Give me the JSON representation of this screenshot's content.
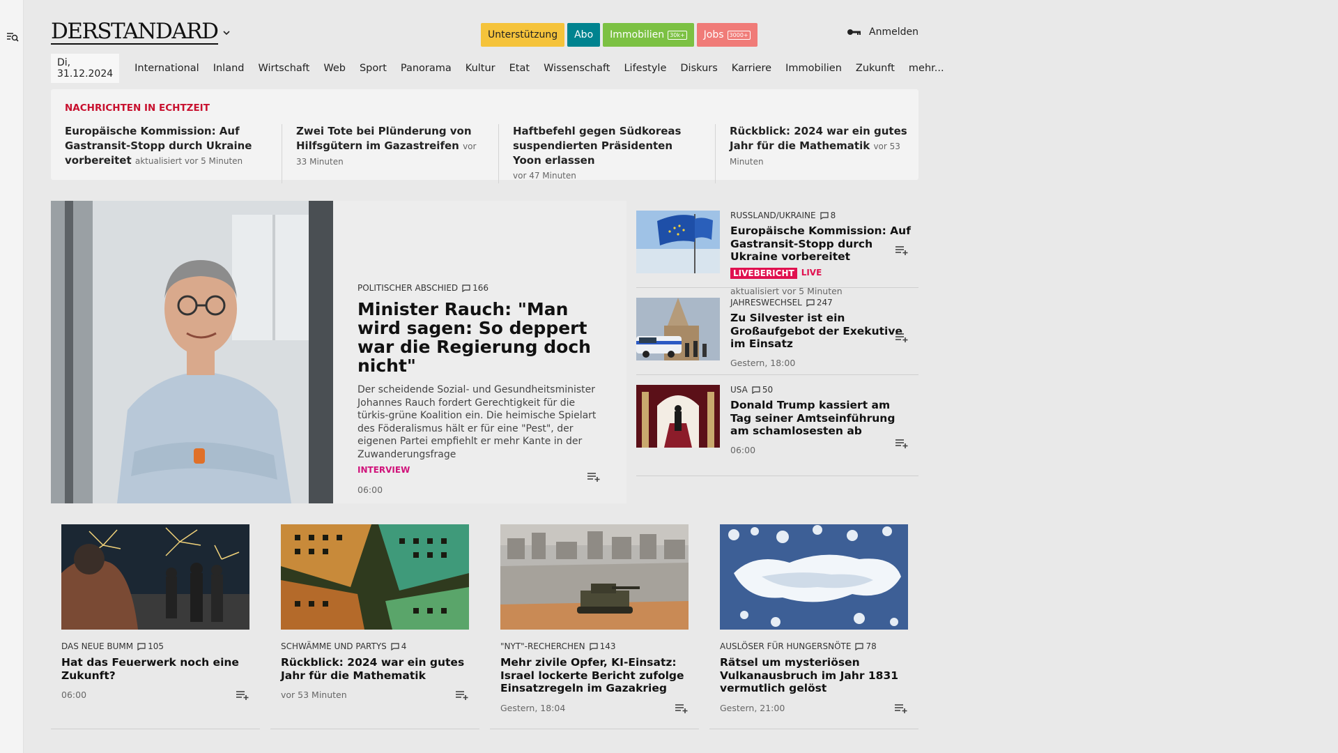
{
  "brand": {
    "logo": "DERSTANDARD"
  },
  "header": {
    "pills": [
      {
        "label": "Unterstützung",
        "badge": "",
        "bg": "#f5c33b",
        "fg": "#222222"
      },
      {
        "label": "Abo",
        "badge": "",
        "bg": "#00838f",
        "fg": "#ffffff"
      },
      {
        "label": "Immobilien",
        "badge": "30k+",
        "bg": "#7cc143",
        "fg": "#ffffff"
      },
      {
        "label": "Jobs",
        "badge": "3000+",
        "bg": "#f07b78",
        "fg": "#ffffff"
      }
    ],
    "login": "Anmelden"
  },
  "nav": {
    "date": "Di, 31.12.2024",
    "items": [
      "International",
      "Inland",
      "Wirtschaft",
      "Web",
      "Sport",
      "Panorama",
      "Kultur",
      "Etat",
      "Wissenschaft",
      "Lifestyle",
      "Diskurs",
      "Karriere",
      "Immobilien",
      "Zukunft",
      "mehr..."
    ]
  },
  "ticker": {
    "title": "NACHRICHTEN IN ECHTZEIT",
    "items": [
      {
        "title": "Europäische Kommission: Auf Gas­transit-Stopp durch Ukraine vorberei­tet",
        "time": "aktualisiert vor 5 Minuten"
      },
      {
        "title": "Zwei Tote bei Plünderung von Hilfsgü­tern im Gazastreifen",
        "time": "vor 33 Minuten"
      },
      {
        "title": "Haftbefehl gegen Südkoreas suspen­dierten Präsidenten Yoon erlassen",
        "time": "vor 47 Minuten"
      },
      {
        "title": "Rückblick: 2024 war ein gutes Jahr für die Mathematik",
        "time": "vor 53 Minuten"
      }
    ]
  },
  "hero": {
    "kicker": "POLITISCHER ABSCHIED",
    "comments": "166",
    "title": "Minister Rauch: \"Man wird sagen: So deppert war die Regierung doch nicht\"",
    "teaser": "Der scheidende Sozial- und Gesundheitsminister Johannes Rauch fordert Gerechtigkeit für die türkis-grüne Koalition ein. Die heimische Spielart des Föderalismus hält er für eine \"Pest\", der eigenen Partei empfiehlt er mehr Kante in der Zuwande­rungsfrage",
    "tag": "INTERVIEW",
    "time": "06:00"
  },
  "side": [
    {
      "kicker": "RUSSLAND/UKRAINE",
      "comments": "8",
      "title": "Europäische Kommission: Auf Gastransit-Stopp durch Ukraine vorbereitet",
      "live_badge": "LIVEBERICHT",
      "live_label": "LIVE",
      "time": "aktualisiert vor 5 Minuten"
    },
    {
      "kicker": "JAHRESWECHSEL",
      "comments": "247",
      "title": "Zu Silvester ist ein Großaufgebot der Exekutive im Einsatz",
      "time": "Gestern, 18:00"
    },
    {
      "kicker": "USA",
      "comments": "50",
      "title": "Donald Trump kassiert am Tag seiner Amtseinführung am schamlosesten ab",
      "time": "06:00"
    }
  ],
  "grid": [
    {
      "kicker": "DAS NEUE BUMM",
      "comments": "105",
      "title": "Hat das Feuerwerk noch eine Zukunft?",
      "time": "06:00"
    },
    {
      "kicker": "SCHWÄMME UND PARTYS",
      "comments": "4",
      "title": "Rückblick: 2024 war ein gutes Jahr für die Mathematik",
      "time": "vor 53 Minuten"
    },
    {
      "kicker": "\"NYT\"-RECHERCHEN",
      "comments": "143",
      "title": "Mehr zivile Opfer, KI-Einsatz: Israel lockerte Bericht zufolge Einsatzregeln im Gazakrieg",
      "time": "Gestern, 18:04"
    },
    {
      "kicker": "AUSLÖSER FÜR HUNGERSNÖTE",
      "comments": "78",
      "title": "Rätsel um mysteriösen Vulkanausbruch im Jahr 1831 vermutlich gelöst",
      "time": "Gestern, 21:00"
    }
  ],
  "icons": {
    "menu": "search-menu-icon",
    "caret": "chevron-down-icon",
    "login": "key-icon",
    "comment": "comment-icon",
    "watchlist": "add-to-list-icon"
  }
}
